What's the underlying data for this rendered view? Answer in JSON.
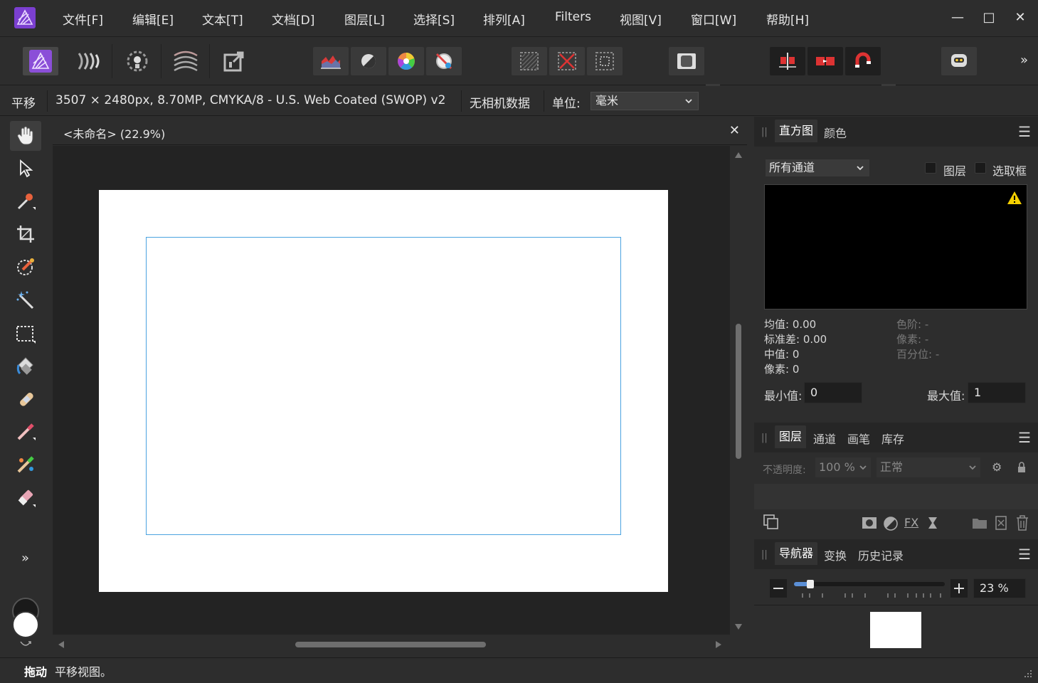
{
  "menu": {
    "items": [
      "文件[F]",
      "编辑[E]",
      "文本[T]",
      "文档[D]",
      "图层[L]",
      "选择[S]",
      "排列[A]",
      "Filters",
      "视图[V]",
      "窗口[W]",
      "帮助[H]"
    ]
  },
  "window_controls": {
    "minimize": "—",
    "maximize": "□",
    "close": "✕"
  },
  "toolbar": {
    "overflow": "»"
  },
  "context_bar": {
    "tool_name": "平移",
    "doc_info": "3507 × 2480px, 8.70MP, CMYKA/8 - U.S. Web Coated (SWOP) v2",
    "camera_data": "无相机数据",
    "unit_label": "单位:",
    "unit_value": "毫米"
  },
  "document": {
    "tab_title": "<未命名> (22.9%)",
    "close": "✕"
  },
  "tools": {
    "more": "»"
  },
  "status": {
    "bold": "拖动",
    "text": "平移视图。"
  },
  "histogram_panel": {
    "tabs": [
      "直方图",
      "颜色"
    ],
    "channel_select": "所有通道",
    "checkbox_layer": "图层",
    "checkbox_marquee": "选取框",
    "stats_left": [
      "均值: 0.00",
      "标准差: 0.00",
      "中值: 0",
      "像素: 0"
    ],
    "stats_right": [
      "色阶: -",
      "像素: -",
      "百分位: -"
    ],
    "min_label": "最小值:",
    "min_value": "0",
    "max_label": "最大值:",
    "max_value": "1"
  },
  "layers_panel": {
    "tabs": [
      "图层",
      "通道",
      "画笔",
      "库存"
    ],
    "opacity_label": "不透明度:",
    "opacity_value": "100 %",
    "blend_mode": "正常"
  },
  "navigator_panel": {
    "tabs": [
      "导航器",
      "变换",
      "历史记录"
    ],
    "zoom_value": "23 %",
    "zoom_fraction": 0.05
  },
  "colors": {
    "accent": "#4aa3e0",
    "app_purple": "#8b4fd8",
    "warning": "#f5d000"
  }
}
